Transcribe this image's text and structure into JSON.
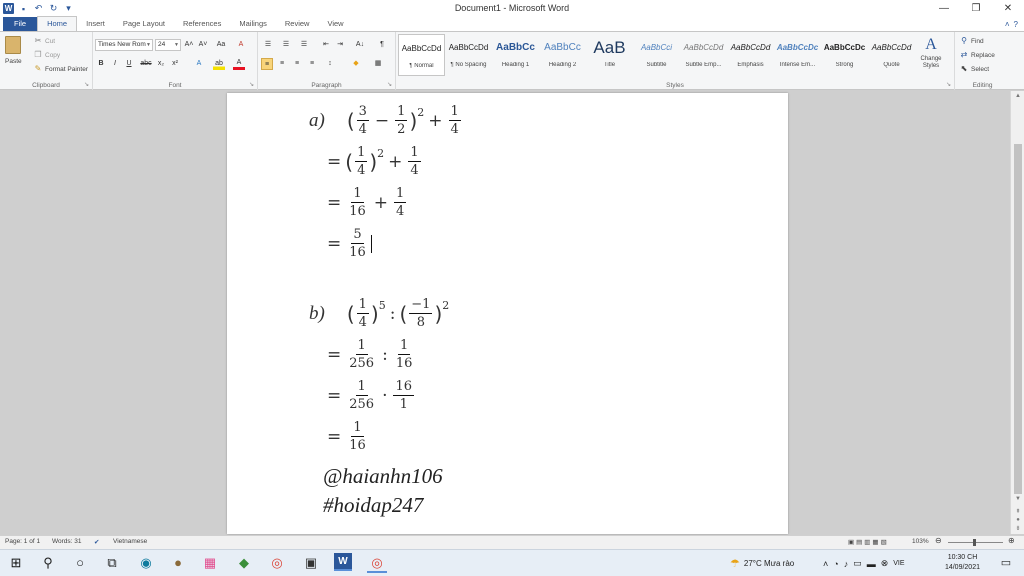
{
  "window": {
    "title": "Document1 - Microsoft Word",
    "controls": {
      "minimize": "—",
      "restore": "❐",
      "close": "✕"
    }
  },
  "qat": {
    "save": "💾",
    "undo": "↶",
    "redo": "↻",
    "customize": "▾"
  },
  "tabs": [
    {
      "label": "File"
    },
    {
      "label": "Home"
    },
    {
      "label": "Insert"
    },
    {
      "label": "Page Layout"
    },
    {
      "label": "References"
    },
    {
      "label": "Mailings"
    },
    {
      "label": "Review"
    },
    {
      "label": "View"
    }
  ],
  "ribbon": {
    "clipboard": {
      "paste": "Paste",
      "cut": "Cut",
      "copy": "Copy",
      "format_painter": "Format Painter",
      "label": "Clipboard"
    },
    "font": {
      "name": "Times New Rom",
      "size": "24",
      "label": "Font",
      "bold": "B",
      "italic": "I",
      "underline": "U",
      "strike": "abc",
      "sub": "x₂",
      "sup": "x²",
      "grow": "A˄",
      "shrink": "A˅",
      "case": "Aa",
      "clear": "A"
    },
    "paragraph": {
      "label": "Paragraph",
      "sort": "A↓",
      "pilcrow": "¶"
    },
    "styles": {
      "label": "Styles",
      "items": [
        {
          "sample": "AaBbCcDd",
          "name": "¶ Normal"
        },
        {
          "sample": "AaBbCcDd",
          "name": "¶ No Spacing"
        },
        {
          "sample": "AaBbCc",
          "name": "Heading 1"
        },
        {
          "sample": "AaBbCc",
          "name": "Heading 2"
        },
        {
          "sample": "AaB",
          "name": "Title"
        },
        {
          "sample": "AaBbCci",
          "name": "Subtitle"
        },
        {
          "sample": "AaBbCcDd",
          "name": "Subtle Emp..."
        },
        {
          "sample": "AaBbCcDd",
          "name": "Emphasis"
        },
        {
          "sample": "AaBbCcDc",
          "name": "Intense Em..."
        },
        {
          "sample": "AaBbCcDc",
          "name": "Strong"
        },
        {
          "sample": "AaBbCcDd",
          "name": "Quote"
        }
      ],
      "change_styles": "Change Styles"
    },
    "editing": {
      "find": "Find",
      "replace": "Replace",
      "select": "Select",
      "label": "Editing"
    }
  },
  "document": {
    "part_a": {
      "label": "a)",
      "line1": {
        "f1n": "3",
        "f1d": "4",
        "f2n": "1",
        "f2d": "2",
        "exp": "2",
        "f3n": "1",
        "f3d": "4"
      },
      "line2": {
        "f1n": "1",
        "f1d": "4",
        "exp": "2",
        "f2n": "1",
        "f2d": "4"
      },
      "line3": {
        "f1n": "1",
        "f1d": "16",
        "f2n": "1",
        "f2d": "4"
      },
      "line4": {
        "f1n": "5",
        "f1d": "16"
      }
    },
    "part_b": {
      "label": "b)",
      "line1": {
        "f1n": "1",
        "f1d": "4",
        "exp1": "5",
        "f2n": "−1",
        "f2d": "8",
        "exp2": "2"
      },
      "line2": {
        "f1n": "1",
        "f1d": "256",
        "f2n": "1",
        "f2d": "16"
      },
      "line3": {
        "f1n": "1",
        "f1d": "256",
        "f2n": "16",
        "f2d": "1"
      },
      "line4": {
        "f1n": "1",
        "f1d": "16"
      }
    },
    "signature1": "@haianhn106",
    "signature2": "#hoidap247"
  },
  "statusbar": {
    "page": "Page: 1 of 1",
    "words": "Words: 31",
    "language": "Vietnamese",
    "zoom": "103%"
  },
  "taskbar": {
    "weather": "27°C  Mưa rào",
    "lang": "VIE",
    "time": "10:30 CH",
    "date": "14/09/2021"
  }
}
